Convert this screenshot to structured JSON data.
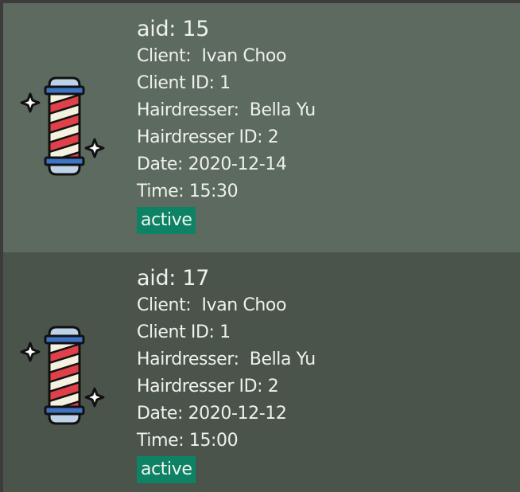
{
  "appointments": [
    {
      "aid": "aid: 15",
      "client": "Client:  Ivan Choo",
      "client_id": "Client ID: 1",
      "hairdresser": "Hairdresser:  Bella Yu",
      "hairdresser_id": "Hairdresser ID: 2",
      "date": "Date: 2020-12-14",
      "time": "Time: 15:30",
      "status": "active",
      "icon": "barber-pole-icon"
    },
    {
      "aid": "aid: 17",
      "client": "Client:  Ivan Choo",
      "client_id": "Client ID: 1",
      "hairdresser": "Hairdresser:  Bella Yu",
      "hairdresser_id": "Hairdresser ID: 2",
      "date": "Date: 2020-12-12",
      "time": "Time: 15:00",
      "status": "active",
      "icon": "barber-pole-icon"
    }
  ],
  "colors": {
    "card_selected": "#5d6a5f",
    "card": "#4b544b",
    "status_active": "#0e8265",
    "text": "#eef1ec"
  }
}
